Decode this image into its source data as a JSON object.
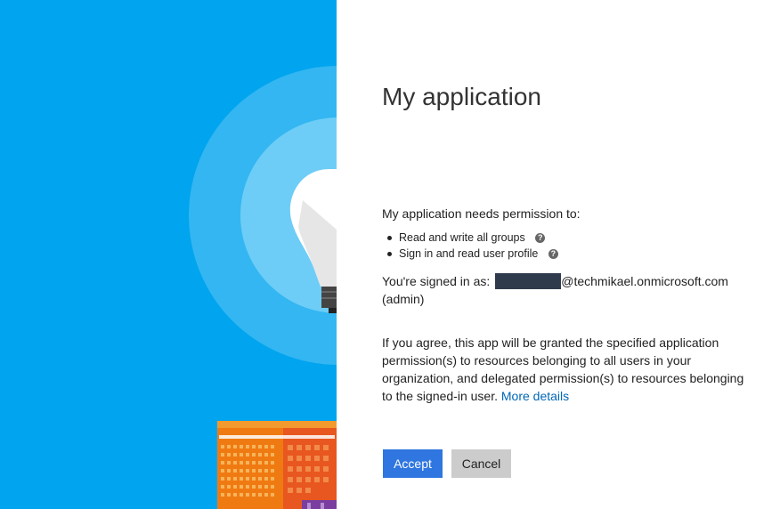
{
  "app": {
    "title": "My application"
  },
  "consent": {
    "intro": "My application needs permission to:",
    "permissions": [
      {
        "label": "Read and write all groups",
        "help_icon": "question-circle-icon"
      },
      {
        "label": "Sign in and read user profile",
        "help_icon": "question-circle-icon"
      }
    ],
    "signed_in_prefix": "You're signed in as:",
    "signed_in_account": "@techmikael.onmicrosoft.com",
    "signed_in_role": "(admin)",
    "agreement_text": "If you agree, this app will be granted the specified application permission(s) to resources belonging to all users in your organization, and delegated permission(s) to resources belonging to the signed-in user.",
    "more_details_link": "More details"
  },
  "actions": {
    "accept_label": "Accept",
    "cancel_label": "Cancel"
  },
  "colors": {
    "hero_background": "#00a4ef",
    "accept": "#2f76e0",
    "cancel": "#cccccc",
    "link": "#0067b8",
    "redaction": "#2f3b4c"
  }
}
